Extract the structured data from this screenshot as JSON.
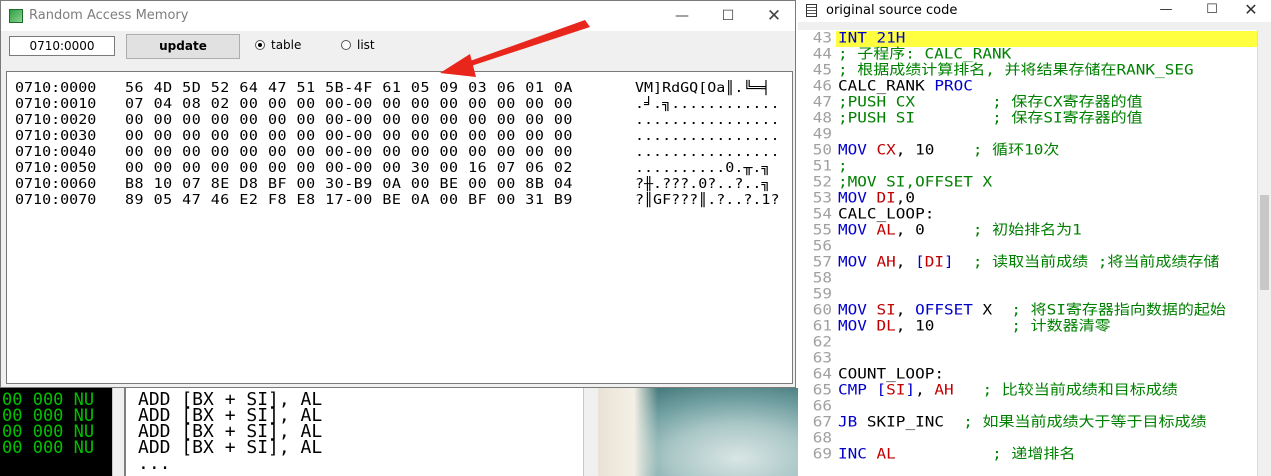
{
  "background": {
    "disasm_lines": [
      {
        "c1": "00 000 NU",
        "c2": ""
      },
      {
        "c1": "00 000 NU",
        "c2": ""
      },
      {
        "c1": "00 000 NU",
        "c2": ""
      },
      {
        "c1": "00 000 NU",
        "c2": ""
      }
    ],
    "asm_lines": [
      "ADD [BX + SI], AL",
      "ADD [BX + SI], AL",
      "ADD [BX + SI], AL",
      "ADD [BX + SI], AL",
      "..."
    ]
  },
  "ram_window": {
    "title": "Random Access Memory",
    "address_value": "0710:0000",
    "update_label": "update",
    "view_options": [
      {
        "label": "table",
        "selected": true
      },
      {
        "label": "list",
        "selected": false
      }
    ],
    "rows": [
      {
        "addr": "0710:0000",
        "hex": "56 4D 5D 52 64 47 51 5B-4F 61 05 09 03 06 01 0A",
        "ascii": "VM]RdGQ[Oa║.╚═╡"
      },
      {
        "addr": "0710:0010",
        "hex": "07 04 08 02 00 00 00 00-00 00 00 00 00 00 00 00",
        "ascii": ".╛.╗............"
      },
      {
        "addr": "0710:0020",
        "hex": "00 00 00 00 00 00 00 00-00 00 00 00 00 00 00 00",
        "ascii": "................"
      },
      {
        "addr": "0710:0030",
        "hex": "00 00 00 00 00 00 00 00-00 00 00 00 00 00 00 00",
        "ascii": "................"
      },
      {
        "addr": "0710:0040",
        "hex": "00 00 00 00 00 00 00 00-00 00 00 00 00 00 00 00",
        "ascii": "................"
      },
      {
        "addr": "0710:0050",
        "hex": "00 00 00 00 00 00 00 00-00 00 30 00 16 07 06 02",
        "ascii": "..........0.╥.╗"
      },
      {
        "addr": "0710:0060",
        "hex": "B8 10 07 8E D8 BF 00 30-B9 0A 00 BE 00 00 8B 04",
        "ascii": "?╫.???.0?..?..╗"
      },
      {
        "addr": "0710:0070",
        "hex": "89 05 47 46 E2 F8 E8 17-00 BE 0A 00 BF 00 31 B9",
        "ascii": "?║GF???║.?..?.1?"
      }
    ]
  },
  "source_window": {
    "title": "original source code",
    "lines": [
      {
        "num": "43",
        "parts": [
          {
            "t": "INT 21H",
            "c": "k"
          }
        ],
        "highlight": true
      },
      {
        "num": "44",
        "parts": [
          {
            "t": "; 子程序: CALC_RANK",
            "c": "cm"
          }
        ]
      },
      {
        "num": "45",
        "parts": [
          {
            "t": "; 根据成绩计算排名, 并将结果存储在RANK_SEG",
            "c": "cm"
          }
        ]
      },
      {
        "num": "46",
        "parts": [
          {
            "t": "CALC_RANK ",
            "c": "n"
          },
          {
            "t": "PROC",
            "c": "k"
          }
        ]
      },
      {
        "num": "47",
        "parts": [
          {
            "t": ";PUSH CX        ; 保存CX寄存器的值",
            "c": "cm"
          }
        ]
      },
      {
        "num": "48",
        "parts": [
          {
            "t": ";PUSH SI        ; 保存SI寄存器的值",
            "c": "cm"
          }
        ]
      },
      {
        "num": "49",
        "parts": [
          {
            "t": "",
            "c": "n"
          }
        ]
      },
      {
        "num": "50",
        "parts": [
          {
            "t": "MOV ",
            "c": "k"
          },
          {
            "t": "CX",
            "c": "r"
          },
          {
            "t": ", 10    ",
            "c": "n"
          },
          {
            "t": "; 循环10次",
            "c": "cm"
          }
        ]
      },
      {
        "num": "51",
        "parts": [
          {
            "t": ";",
            "c": "cm"
          }
        ]
      },
      {
        "num": "52",
        "parts": [
          {
            "t": ";MOV SI,OFFSET X",
            "c": "cm"
          }
        ]
      },
      {
        "num": "53",
        "parts": [
          {
            "t": "MOV ",
            "c": "k"
          },
          {
            "t": "DI",
            "c": "r"
          },
          {
            "t": ",0",
            "c": "n"
          }
        ]
      },
      {
        "num": "54",
        "parts": [
          {
            "t": "CALC_LOOP:",
            "c": "n"
          }
        ]
      },
      {
        "num": "55",
        "parts": [
          {
            "t": "MOV ",
            "c": "k"
          },
          {
            "t": "AL",
            "c": "r"
          },
          {
            "t": ", 0     ",
            "c": "n"
          },
          {
            "t": "; 初始排名为1",
            "c": "cm"
          }
        ]
      },
      {
        "num": "56",
        "parts": [
          {
            "t": "",
            "c": "n"
          }
        ]
      },
      {
        "num": "57",
        "parts": [
          {
            "t": "MOV ",
            "c": "k"
          },
          {
            "t": "AH",
            "c": "r"
          },
          {
            "t": ", ",
            "c": "n"
          },
          {
            "t": "[",
            "c": "k"
          },
          {
            "t": "DI",
            "c": "r"
          },
          {
            "t": "]",
            "c": "k"
          },
          {
            "t": "  ",
            "c": "n"
          },
          {
            "t": "; 读取当前成绩 ;将当前成绩存储",
            "c": "cm"
          }
        ]
      },
      {
        "num": "58",
        "parts": [
          {
            "t": "",
            "c": "n"
          }
        ]
      },
      {
        "num": "59",
        "parts": [
          {
            "t": "",
            "c": "n"
          }
        ]
      },
      {
        "num": "60",
        "parts": [
          {
            "t": "MOV ",
            "c": "k"
          },
          {
            "t": "SI",
            "c": "r"
          },
          {
            "t": ", ",
            "c": "n"
          },
          {
            "t": "OFFSET",
            "c": "k"
          },
          {
            "t": " X  ",
            "c": "n"
          },
          {
            "t": "; 将SI寄存器指向数据的起始",
            "c": "cm"
          }
        ]
      },
      {
        "num": "61",
        "parts": [
          {
            "t": "MOV ",
            "c": "k"
          },
          {
            "t": "DL",
            "c": "r"
          },
          {
            "t": ", 10        ",
            "c": "n"
          },
          {
            "t": "; 计数器清零",
            "c": "cm"
          }
        ]
      },
      {
        "num": "62",
        "parts": [
          {
            "t": "",
            "c": "n"
          }
        ]
      },
      {
        "num": "63",
        "parts": [
          {
            "t": "",
            "c": "n"
          }
        ]
      },
      {
        "num": "64",
        "parts": [
          {
            "t": "COUNT_LOOP:",
            "c": "n"
          }
        ]
      },
      {
        "num": "65",
        "parts": [
          {
            "t": "CMP ",
            "c": "k"
          },
          {
            "t": "[",
            "c": "k"
          },
          {
            "t": "SI",
            "c": "r"
          },
          {
            "t": "]",
            "c": "k"
          },
          {
            "t": ", ",
            "c": "n"
          },
          {
            "t": "AH",
            "c": "r"
          },
          {
            "t": "   ",
            "c": "n"
          },
          {
            "t": "; 比较当前成绩和目标成绩",
            "c": "cm"
          }
        ]
      },
      {
        "num": "66",
        "parts": [
          {
            "t": "",
            "c": "n"
          }
        ]
      },
      {
        "num": "67",
        "parts": [
          {
            "t": "JB ",
            "c": "k"
          },
          {
            "t": "SKIP_INC  ",
            "c": "n"
          },
          {
            "t": "; 如果当前成绩大于等于目标成绩",
            "c": "cm"
          }
        ]
      },
      {
        "num": "68",
        "parts": [
          {
            "t": "",
            "c": "n"
          }
        ]
      },
      {
        "num": "69",
        "parts": [
          {
            "t": "INC ",
            "c": "k"
          },
          {
            "t": "AL",
            "c": "r"
          },
          {
            "t": "          ",
            "c": "n"
          },
          {
            "t": "; 递增排名",
            "c": "cm"
          }
        ]
      }
    ]
  }
}
